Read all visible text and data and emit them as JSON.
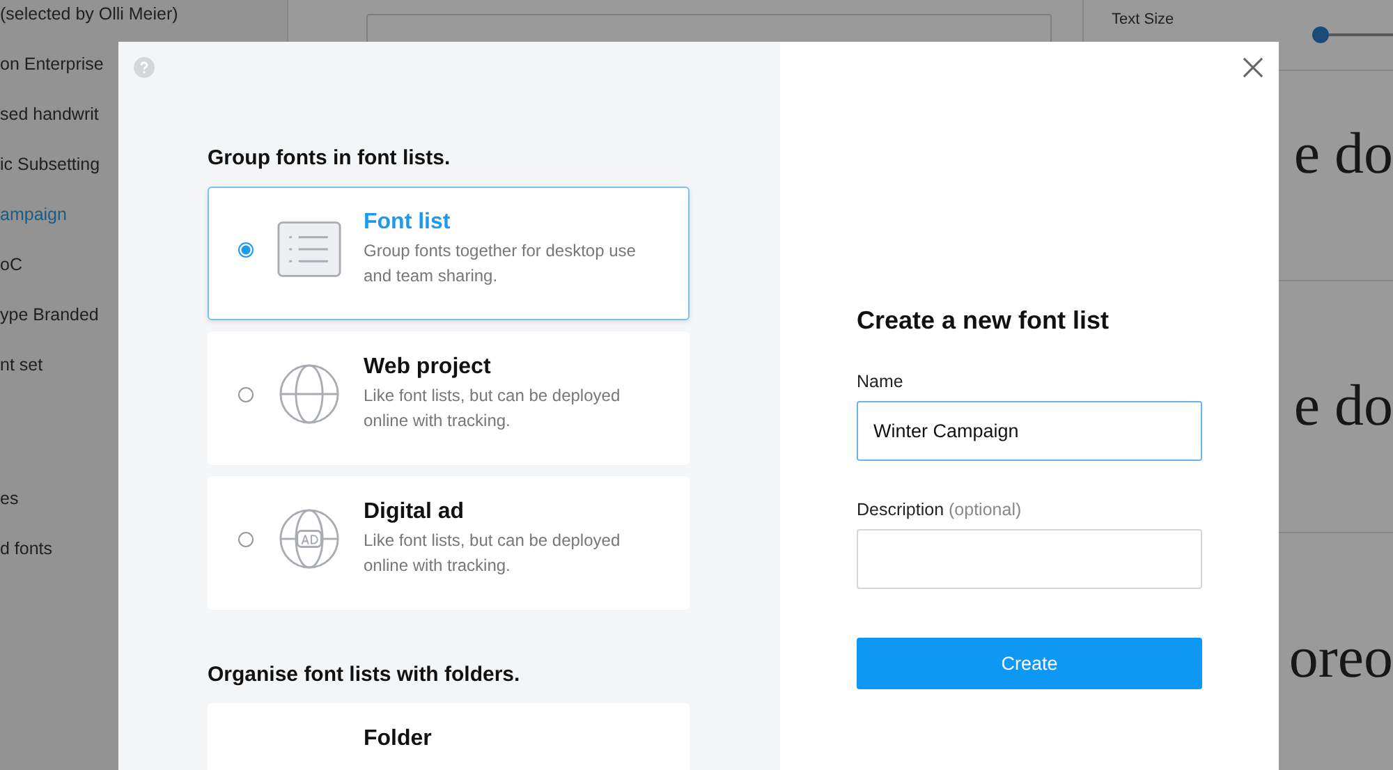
{
  "background": {
    "sidebar_items": [
      {
        "label": "(selected by Olli Meier)",
        "selected": false
      },
      {
        "label": "on Enterprise",
        "selected": false
      },
      {
        "label": "sed handwrit",
        "selected": false
      },
      {
        "label": "ic Subsetting",
        "selected": false
      },
      {
        "label": "ampaign",
        "selected": true
      },
      {
        "label": "oC",
        "selected": false
      },
      {
        "label": "ype Branded",
        "selected": false
      },
      {
        "label": "nt set",
        "selected": false
      }
    ],
    "sidebar_items_lower": [
      {
        "label": "es",
        "selected": false
      },
      {
        "label": "d fonts",
        "selected": false
      }
    ],
    "text_size": {
      "label": "Text Size",
      "level": 0
    },
    "previews": [
      "e do",
      "e do",
      "oreo"
    ]
  },
  "dialog": {
    "sections": [
      {
        "heading": "Group fonts in font lists.",
        "options": [
          {
            "kind": "list",
            "title": "Font list",
            "description": "Group fonts together for desktop use and team sharing.",
            "selected": true
          },
          {
            "kind": "web",
            "title": "Web project",
            "description": "Like font lists, but can be deployed online with tracking.",
            "selected": false
          },
          {
            "kind": "ad",
            "title": "Digital ad",
            "description": "Like font lists, but can be deployed online with tracking.",
            "selected": false
          }
        ]
      },
      {
        "heading": "Organise font lists with folders.",
        "options": [
          {
            "kind": "folder",
            "title": "Folder"
          }
        ]
      }
    ],
    "form": {
      "title": "Create a new font list",
      "fields": [
        {
          "label": "Name",
          "value": "Winter Campaign",
          "focused": true
        },
        {
          "label": "Description",
          "hint": "(optional)",
          "focused": false
        }
      ],
      "button": "Create"
    }
  }
}
